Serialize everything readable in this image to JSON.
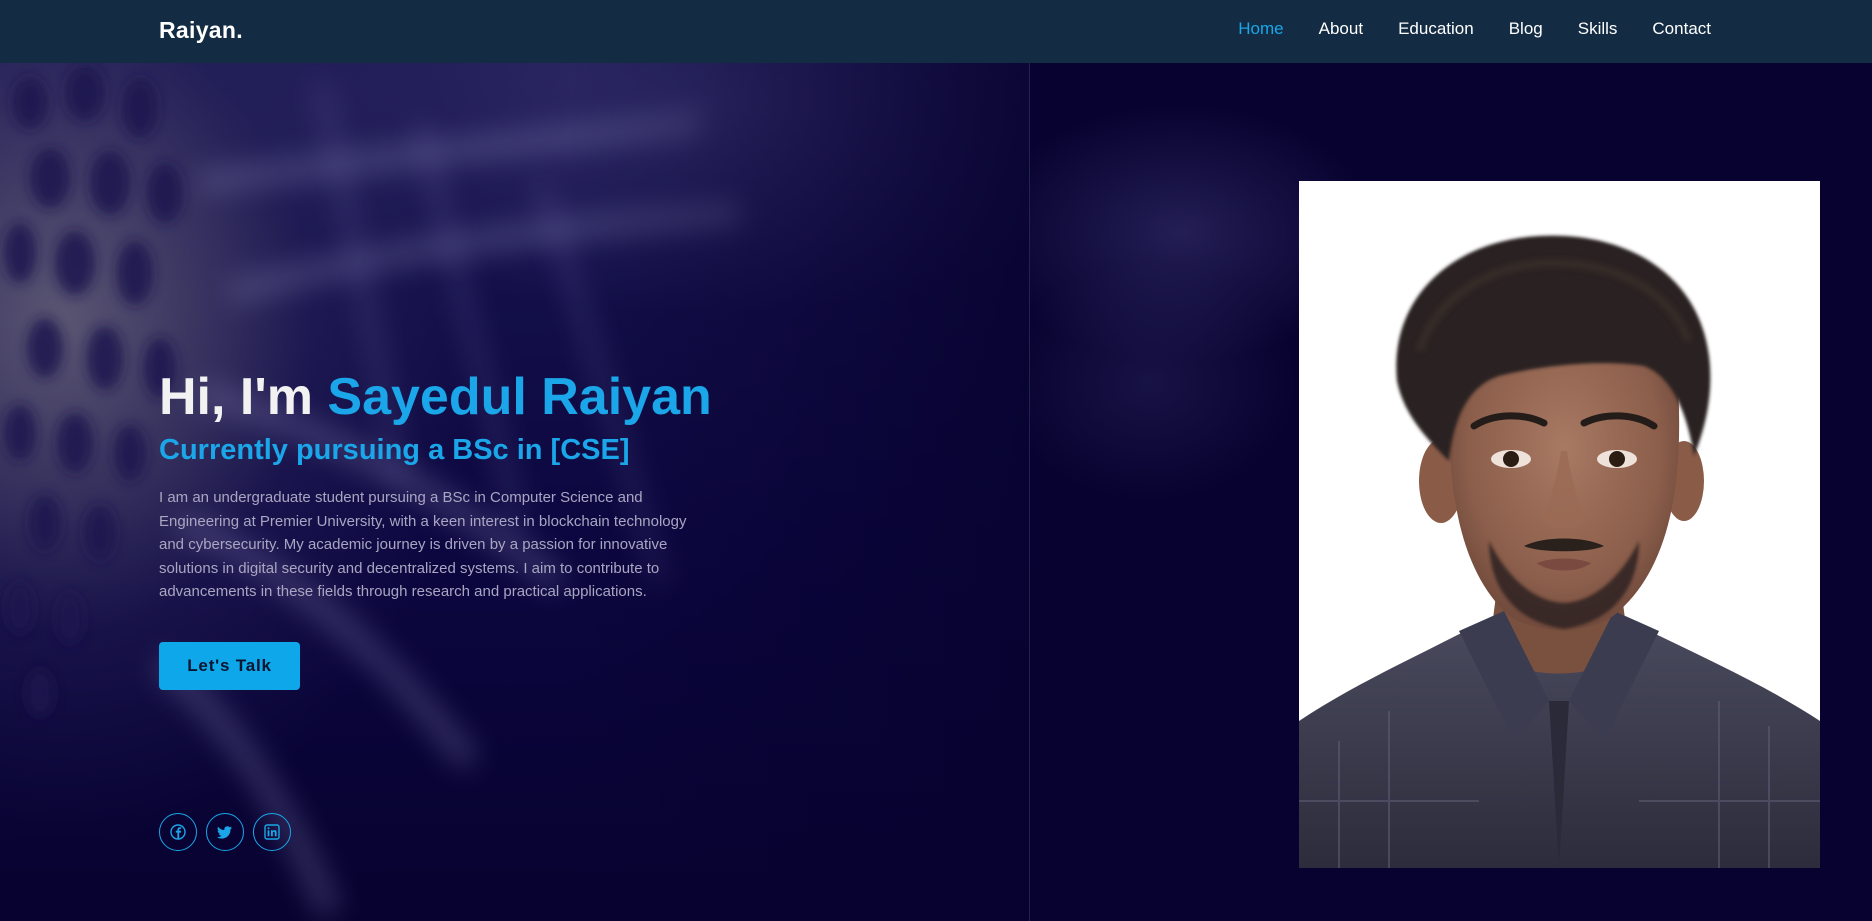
{
  "header": {
    "logo": "Raiyan.",
    "nav": {
      "home": "Home",
      "about": "About",
      "education": "Education",
      "blog": "Blog",
      "skills": "Skills",
      "contact": "Contact"
    },
    "active_item": "Home"
  },
  "hero": {
    "greeting": "Hi, I'm ",
    "name": "Sayedul Raiyan",
    "subtitle": "Currently pursuing a BSc in [CSE]",
    "description": "I am an undergraduate student pursuing a BSc in Computer Science and Engineering at Premier University, with a keen interest in blockchain technology and cybersecurity. My academic journey is driven by a passion for innovative solutions in digital security and decentralized systems. I aim to contribute to advancements in these fields through research and practical applications.",
    "cta_label": "Let's Talk"
  },
  "socials": [
    {
      "icon": "facebook-icon"
    },
    {
      "icon": "twitter-icon"
    },
    {
      "icon": "linkedin-icon"
    }
  ],
  "portrait": {
    "icon": "profile-photo"
  },
  "colors": {
    "accent": "#1aa6e8",
    "header_bg": "#132c44",
    "page_bg": "#07022f",
    "button_bg": "#0ea7ea",
    "body_text": "#a8a6c2"
  }
}
